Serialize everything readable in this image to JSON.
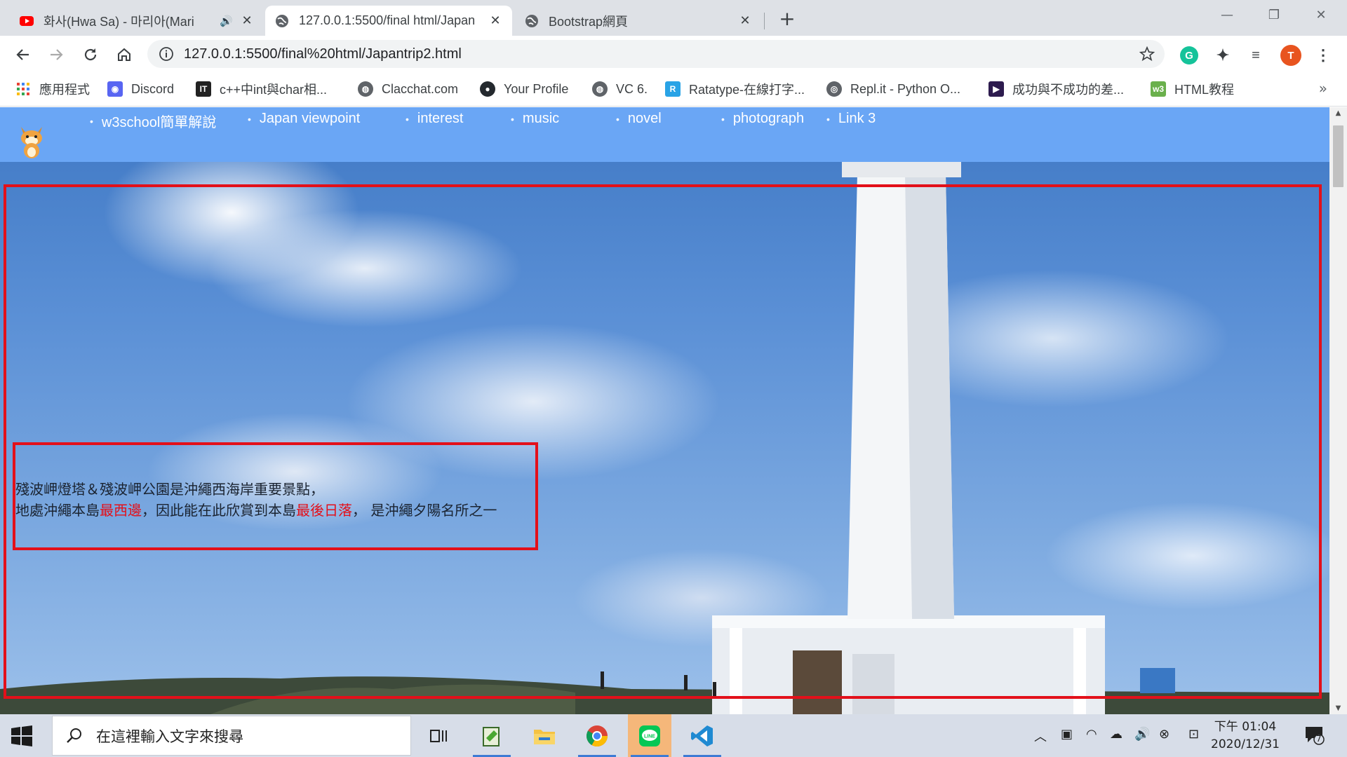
{
  "browser": {
    "tabs": [
      {
        "title": "화사(Hwa Sa) - 마리아(Mari",
        "favicon": "youtube-icon",
        "audio": true
      },
      {
        "title": "127.0.0.1:5500/final html/Japan",
        "favicon": "globe-icon",
        "active": true
      },
      {
        "title": "Bootstrap網頁",
        "favicon": "globe-icon"
      }
    ],
    "url": "127.0.0.1:5500/final%20html/Japantrip2.html",
    "profile_initial": "T",
    "bookmarks": [
      {
        "label": "應用程式",
        "icon": "apps-grid-icon"
      },
      {
        "label": "Discord",
        "icon": "discord-icon"
      },
      {
        "label": "c++中int與char相...",
        "icon": "ithome-icon"
      },
      {
        "label": "Clacchat.com",
        "icon": "globe-icon"
      },
      {
        "label": "Your Profile",
        "icon": "github-icon"
      },
      {
        "label": "VC 6.",
        "icon": "globe-icon"
      },
      {
        "label": "Ratatype-在線打字...",
        "icon": "ratatype-icon"
      },
      {
        "label": "Repl.it - Python O...",
        "icon": "replit-icon"
      },
      {
        "label": "成功與不成功的差...",
        "icon": "video-icon"
      },
      {
        "label": "HTML教程",
        "icon": "w3-icon"
      }
    ]
  },
  "page": {
    "nav": [
      "w3school簡單解說",
      "Japan viewpoint",
      "interest",
      "music",
      "novel",
      "photograph",
      "Link 3"
    ],
    "description": {
      "line1": "殘波岬燈塔＆殘波岬公園是沖繩西海岸重要景點，",
      "line2_a": "地處沖繩本島",
      "line2_hl1": "最西邊",
      "line2_b": "，因此能在此欣賞到本島",
      "line2_hl2": "最後日落",
      "line2_c": "，  是沖繩夕陽名所之一"
    },
    "colors": {
      "nav_bg": "#6aa6f5",
      "frame": "#e3101a",
      "highlight": "#e3101a"
    }
  },
  "taskbar": {
    "search_placeholder": "在這裡輸入文字來搜尋",
    "apps": [
      "task-view-icon",
      "notepad-icon",
      "file-explorer-icon",
      "chrome-icon",
      "line-icon",
      "vscode-icon"
    ],
    "time": "下午 01:04",
    "date": "2020/12/31",
    "notifications": "7"
  }
}
